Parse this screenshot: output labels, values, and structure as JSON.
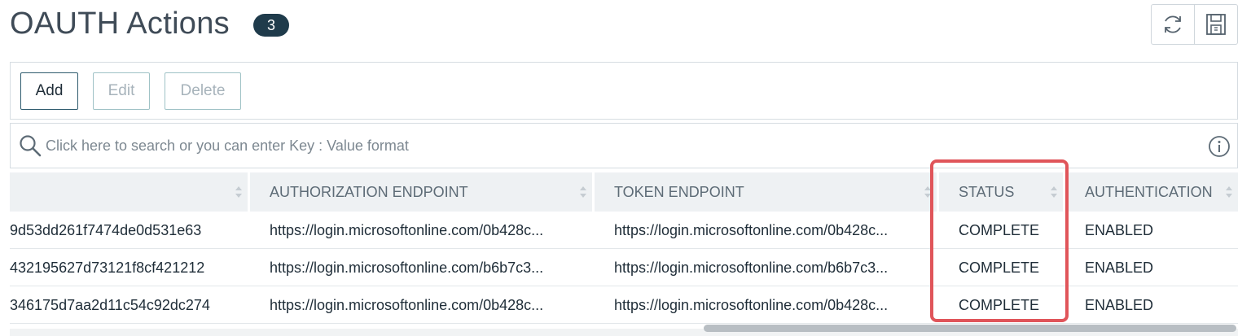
{
  "header": {
    "title": "OAUTH Actions",
    "count": "3"
  },
  "toolbar": {
    "add_label": "Add",
    "edit_label": "Edit",
    "delete_label": "Delete"
  },
  "search": {
    "placeholder": "Click here to search or you can enter Key : Value format"
  },
  "table": {
    "columns": [
      "",
      "AUTHORIZATION ENDPOINT",
      "TOKEN ENDPOINT",
      "STATUS",
      "AUTHENTICATION"
    ],
    "rows": [
      [
        "9d53dd261f7474de0d531e63",
        "https://login.microsoftonline.com/0b428c...",
        "https://login.microsoftonline.com/0b428c...",
        "COMPLETE",
        "ENABLED"
      ],
      [
        "432195627d73121f8cf421212",
        "https://login.microsoftonline.com/b6b7c3...",
        "https://login.microsoftonline.com/b6b7c3...",
        "COMPLETE",
        "ENABLED"
      ],
      [
        "346175d7aa2d11c54c92dc274",
        "https://login.microsoftonline.com/0b428c...",
        "https://login.microsoftonline.com/0b428c...",
        "COMPLETE",
        "ENABLED"
      ]
    ]
  },
  "icons": {
    "refresh": "refresh-icon",
    "save": "save-icon",
    "search": "search-icon",
    "info": "info-icon"
  },
  "colors": {
    "badge": "#1f3b4b",
    "highlight": "#e0555a",
    "header_bg": "#eef1f3"
  }
}
